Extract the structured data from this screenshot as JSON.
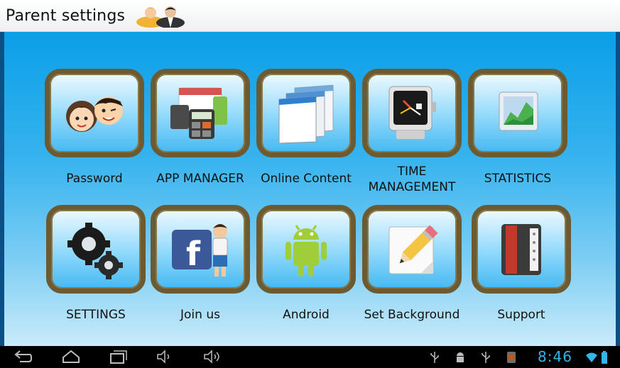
{
  "header": {
    "title": "Parent settings",
    "icon": "parents-icon"
  },
  "tiles": [
    {
      "label": "Password",
      "icon": "kids-faces-icon"
    },
    {
      "label": "APP MANAGER",
      "icon": "calculator-calendar-icon"
    },
    {
      "label": "Online Content",
      "icon": "browser-windows-icon"
    },
    {
      "label": "TIME MANAGEMENT",
      "icon": "clock-icon"
    },
    {
      "label": "STATISTICS",
      "icon": "chart-icon"
    },
    {
      "label": "SETTINGS",
      "icon": "gears-icon"
    },
    {
      "label": "Join us",
      "icon": "facebook-boy-icon"
    },
    {
      "label": "Android",
      "icon": "android-icon"
    },
    {
      "label": "Set Background",
      "icon": "pencil-paper-icon"
    },
    {
      "label": "Support",
      "icon": "address-book-icon"
    }
  ],
  "navbar": {
    "buttons": [
      "back-icon",
      "home-icon",
      "recent-apps-icon",
      "volume-down-icon",
      "volume-up-icon"
    ],
    "status": {
      "clock": "8:46",
      "icons": [
        "usb-icon",
        "android-debug-icon",
        "usb-icon",
        "app-notification-icon",
        "wifi-icon",
        "battery-icon"
      ]
    }
  },
  "colors": {
    "tile_border": "#6b5a32",
    "clock": "#33b5e5",
    "background_top": "#0b9fe8"
  }
}
